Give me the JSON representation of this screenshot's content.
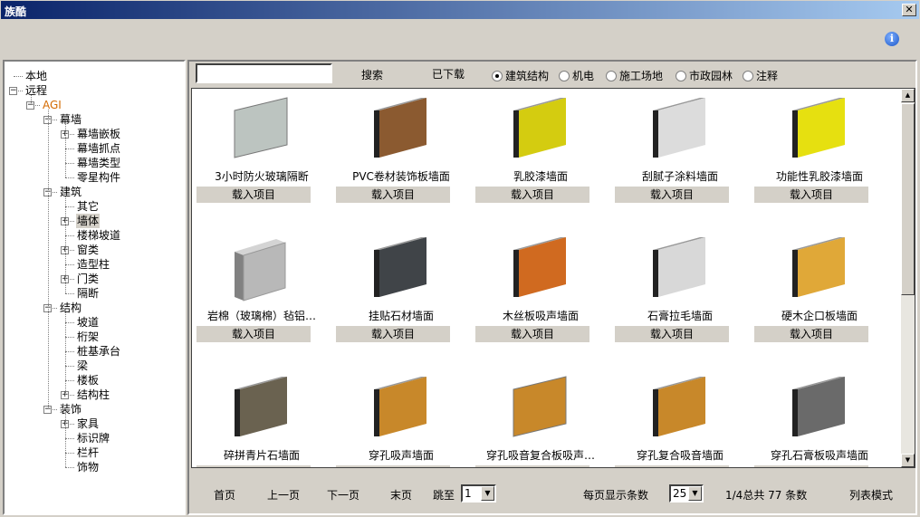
{
  "window": {
    "title": "族酷",
    "close": "✕",
    "info_icon": "info-icon"
  },
  "toolbar": {
    "search_value": "",
    "search_label": "搜索",
    "downloaded_label": "已下载",
    "categories": [
      {
        "label": "建筑结构",
        "selected": true
      },
      {
        "label": "机电",
        "selected": false
      },
      {
        "label": "施工场地",
        "selected": false
      },
      {
        "label": "市政园林",
        "selected": false
      },
      {
        "label": "注释",
        "selected": false
      }
    ]
  },
  "tree": [
    {
      "label": "本地",
      "level": 0,
      "expander": ""
    },
    {
      "label": "远程",
      "level": 0,
      "expander": "minus"
    },
    {
      "label": "AGI",
      "level": 1,
      "expander": "minus"
    },
    {
      "label": "幕墙",
      "level": 2,
      "expander": "minus"
    },
    {
      "label": "幕墙嵌板",
      "level": 3,
      "expander": "plus"
    },
    {
      "label": "幕墙抓点",
      "level": 3,
      "expander": ""
    },
    {
      "label": "幕墙类型",
      "level": 3,
      "expander": ""
    },
    {
      "label": "零星构件",
      "level": 3,
      "expander": ""
    },
    {
      "label": "建筑",
      "level": 2,
      "expander": "minus"
    },
    {
      "label": "其它",
      "level": 3,
      "expander": ""
    },
    {
      "label": "墙体",
      "level": 3,
      "expander": "plus",
      "selected": true
    },
    {
      "label": "楼梯坡道",
      "level": 3,
      "expander": ""
    },
    {
      "label": "窗类",
      "level": 3,
      "expander": "plus"
    },
    {
      "label": "造型柱",
      "level": 3,
      "expander": ""
    },
    {
      "label": "门类",
      "level": 3,
      "expander": "plus"
    },
    {
      "label": "隔断",
      "level": 3,
      "expander": ""
    },
    {
      "label": "结构",
      "level": 2,
      "expander": "minus"
    },
    {
      "label": "坡道",
      "level": 3,
      "expander": ""
    },
    {
      "label": "桁架",
      "level": 3,
      "expander": ""
    },
    {
      "label": "桩基承台",
      "level": 3,
      "expander": ""
    },
    {
      "label": "梁",
      "level": 3,
      "expander": ""
    },
    {
      "label": "楼板",
      "level": 3,
      "expander": ""
    },
    {
      "label": "结构柱",
      "level": 3,
      "expander": "plus"
    },
    {
      "label": "装饰",
      "level": 2,
      "expander": "minus"
    },
    {
      "label": "家具",
      "level": 3,
      "expander": "plus"
    },
    {
      "label": "标识牌",
      "level": 3,
      "expander": ""
    },
    {
      "label": "栏杆",
      "level": 3,
      "expander": ""
    },
    {
      "label": "饰物",
      "level": 3,
      "expander": ""
    }
  ],
  "items": [
    {
      "name": "3小时防火玻璃隔断",
      "color": "#bcc4c0",
      "style": "thin"
    },
    {
      "name": "PVC卷材装饰板墙面",
      "color": "#8b5a30",
      "style": "thick"
    },
    {
      "name": "乳胶漆墙面",
      "color": "#d4cc10",
      "style": "thick"
    },
    {
      "name": "刮腻子涂料墙面",
      "color": "#dcdcdc",
      "style": "thick"
    },
    {
      "name": "功能性乳胶漆墙面",
      "color": "#e6e010",
      "style": "thick"
    },
    {
      "name": "岩棉（玻璃棉）毡铝…",
      "color": "#b8b8b8",
      "style": "box"
    },
    {
      "name": "挂贴石材墙面",
      "color": "#404448",
      "style": "thick"
    },
    {
      "name": "木丝板吸声墙面",
      "color": "#d06a20",
      "style": "thick"
    },
    {
      "name": "石膏拉毛墙面",
      "color": "#d8d8d8",
      "style": "thick"
    },
    {
      "name": "硬木企口板墙面",
      "color": "#e0a838",
      "style": "thick"
    },
    {
      "name": "碎拼青片石墙面",
      "color": "#6a6250",
      "style": "thick"
    },
    {
      "name": "穿孔吸声墙面",
      "color": "#c8882a",
      "style": "thick"
    },
    {
      "name": "穿孔吸音复合板吸声…",
      "color": "#c8882a",
      "style": "thin"
    },
    {
      "name": "穿孔复合吸音墙面",
      "color": "#c8882a",
      "style": "thick"
    },
    {
      "name": "穿孔石膏板吸声墙面",
      "color": "#6a6a6a",
      "style": "thick"
    }
  ],
  "load_label": "载入项目",
  "footer": {
    "first": "首页",
    "prev": "上一页",
    "next": "下一页",
    "last": "末页",
    "jump_label": "跳至",
    "jump_value": "1",
    "per_page_label": "每页显示条数",
    "per_page_value": "25",
    "page_info": "1/4总共 77 条数",
    "list_mode": "列表模式"
  }
}
